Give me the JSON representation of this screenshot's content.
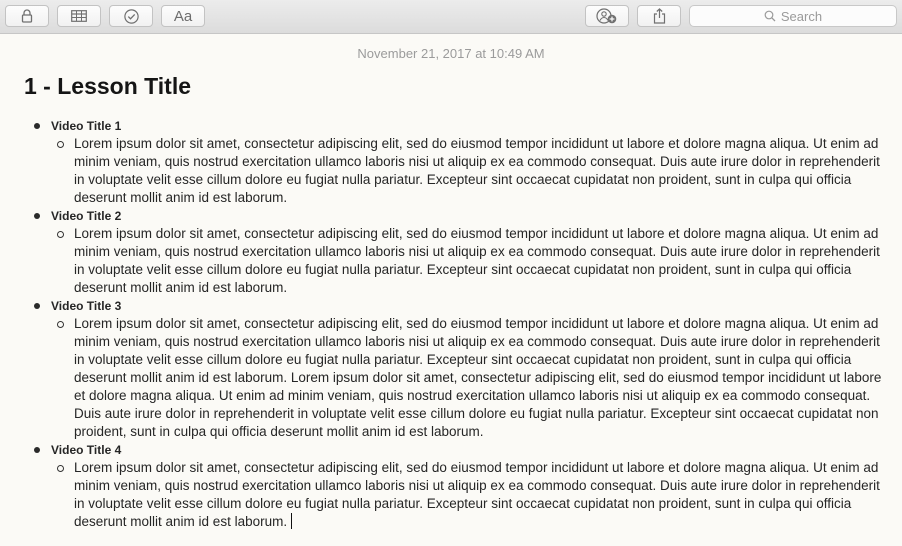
{
  "toolbar": {
    "buttons": [
      {
        "name": "lock-button",
        "icon": "lock-icon"
      },
      {
        "name": "table-button",
        "icon": "table-icon"
      },
      {
        "name": "checklist-button",
        "icon": "checkmark-circle-icon"
      },
      {
        "name": "format-button",
        "icon": "text-format-icon",
        "label": "Aa"
      },
      {
        "name": "add-people-button",
        "icon": "add-people-icon"
      },
      {
        "name": "share-button",
        "icon": "share-icon"
      }
    ],
    "search_placeholder": "Search"
  },
  "note": {
    "date": "November 21, 2017 at 10:49 AM",
    "title": "1 - Lesson Title",
    "videos": [
      {
        "title": "Video Title 1",
        "text": "Lorem ipsum dolor sit amet, consectetur adipiscing elit, sed do eiusmod tempor incididunt ut labore et dolore magna aliqua. Ut enim ad minim veniam, quis nostrud exercitation ullamco laboris nisi ut aliquip ex ea commodo consequat. Duis aute irure dolor in reprehenderit in voluptate velit esse cillum dolore eu fugiat nulla pariatur. Excepteur sint occaecat cupidatat non proident, sunt in culpa qui officia deserunt mollit anim id est laborum."
      },
      {
        "title": "Video Title 2",
        "text": "Lorem ipsum dolor sit amet, consectetur adipiscing elit, sed do eiusmod tempor incididunt ut labore et dolore magna aliqua. Ut enim ad minim veniam, quis nostrud exercitation ullamco laboris nisi ut aliquip ex ea commodo consequat. Duis aute irure dolor in reprehenderit in voluptate velit esse cillum dolore eu fugiat nulla pariatur. Excepteur sint occaecat cupidatat non proident, sunt in culpa qui officia deserunt mollit anim id est laborum."
      },
      {
        "title": "Video Title 3",
        "text": "Lorem ipsum dolor sit amet, consectetur adipiscing elit, sed do eiusmod tempor incididunt ut labore et dolore magna aliqua. Ut enim ad minim veniam, quis nostrud exercitation ullamco laboris nisi ut aliquip ex ea commodo consequat. Duis aute irure dolor in reprehenderit in voluptate velit esse cillum dolore eu fugiat nulla pariatur. Excepteur sint occaecat cupidatat non proident, sunt in culpa qui officia deserunt mollit anim id est laborum.  Lorem ipsum dolor sit amet, consectetur adipiscing elit, sed do eiusmod tempor incididunt ut labore et dolore magna aliqua. Ut enim ad minim veniam, quis nostrud exercitation ullamco laboris nisi ut aliquip ex ea commodo consequat. Duis aute irure dolor in reprehenderit in voluptate velit esse cillum dolore eu fugiat nulla pariatur. Excepteur sint occaecat cupidatat non proident, sunt in culpa qui officia deserunt mollit anim id est laborum."
      },
      {
        "title": "Video Title 4",
        "text": "Lorem ipsum dolor sit amet, consectetur adipiscing elit, sed do eiusmod tempor incididunt ut labore et dolore magna aliqua. Ut enim ad minim veniam, quis nostrud exercitation ullamco laboris nisi ut aliquip ex ea commodo consequat. Duis aute irure dolor in reprehenderit in voluptate velit esse cillum dolore eu fugiat nulla pariatur. Excepteur sint occaecat cupidatat non proident, sunt in culpa qui officia deserunt mollit anim id est laborum."
      }
    ]
  }
}
